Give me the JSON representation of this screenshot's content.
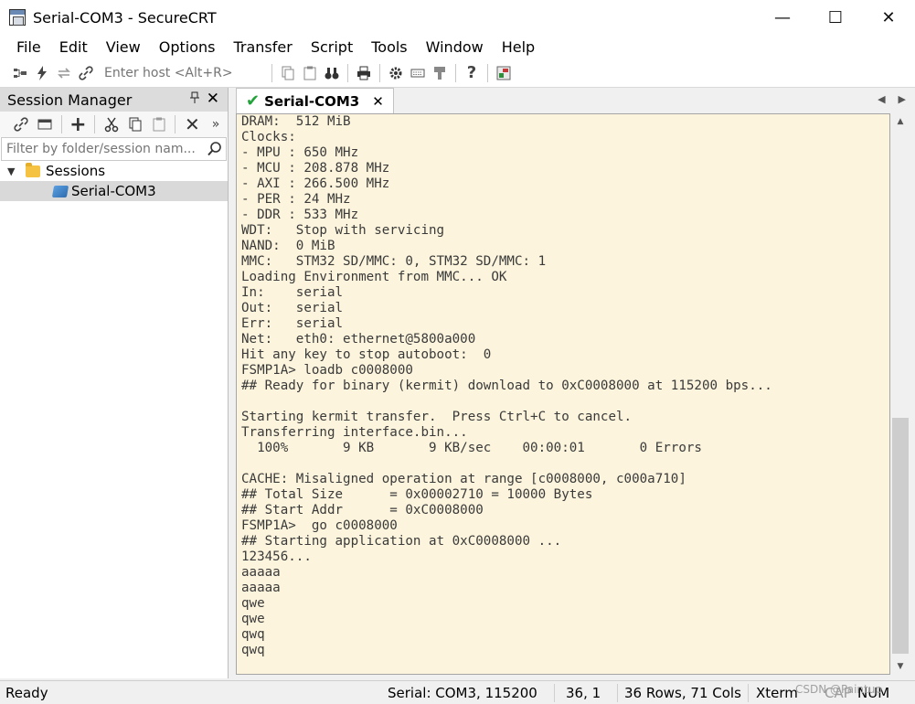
{
  "window": {
    "title": "Serial-COM3 - SecureCRT",
    "controls": {
      "minimize": "—",
      "maximize": "☐",
      "close": "✕"
    }
  },
  "menu": [
    "File",
    "Edit",
    "View",
    "Options",
    "Transfer",
    "Script",
    "Tools",
    "Window",
    "Help"
  ],
  "toolbar": {
    "host_placeholder": "Enter host <Alt+R>",
    "icons": [
      "connect-icon",
      "quick-connect-icon",
      "reconnect-icon",
      "link-icon",
      "copy-icon",
      "paste-icon",
      "find-icon",
      "print-icon",
      "settings-icon",
      "keymap-icon",
      "sftp-icon",
      "help-icon",
      "script-icon"
    ]
  },
  "session_manager": {
    "title": "Session Manager",
    "pin": "📌",
    "close": "✕",
    "filter_placeholder": "Filter by folder/session nam...",
    "tree": {
      "folder": "Sessions",
      "session": "Serial-COM3"
    }
  },
  "tab": {
    "label": "Serial-COM3",
    "close": "✕"
  },
  "terminal": {
    "lines": [
      "DRAM:  512 MiB",
      "Clocks:",
      "- MPU : 650 MHz",
      "- MCU : 208.878 MHz",
      "- AXI : 266.500 MHz",
      "- PER : 24 MHz",
      "- DDR : 533 MHz",
      "WDT:   Stop with servicing",
      "NAND:  0 MiB",
      "MMC:   STM32 SD/MMC: 0, STM32 SD/MMC: 1",
      "Loading Environment from MMC... OK",
      "In:    serial",
      "Out:   serial",
      "Err:   serial",
      "Net:   eth0: ethernet@5800a000",
      "Hit any key to stop autoboot:  0",
      "FSMP1A> loadb c0008000",
      "## Ready for binary (kermit) download to 0xC0008000 at 115200 bps...",
      "",
      "Starting kermit transfer.  Press Ctrl+C to cancel.",
      "Transferring interface.bin...",
      "  100%       9 KB       9 KB/sec    00:00:01       0 Errors",
      "",
      "CACHE: Misaligned operation at range [c0008000, c000a710]",
      "## Total Size      = 0x00002710 = 10000 Bytes",
      "## Start Addr      = 0xC0008000",
      "FSMP1A>  go c0008000",
      "## Starting application at 0xC0008000 ...",
      "123456...",
      "aaaaa",
      "aaaaa",
      "qwe",
      "qwe",
      "qwq",
      "qwq"
    ]
  },
  "status": {
    "ready": "Ready",
    "connection": "Serial: COM3, 115200",
    "cursor": "36,   1",
    "size": "36 Rows, 71 Cols",
    "emulation": "Xterm",
    "cap": "CAP",
    "num": "NUM",
    "watermark": "CSDN @Paintup"
  },
  "colors": {
    "terminal_bg": "#fcf4dc",
    "terminal_fg": "#3a3a3a",
    "connected_check": "#22a33a"
  }
}
